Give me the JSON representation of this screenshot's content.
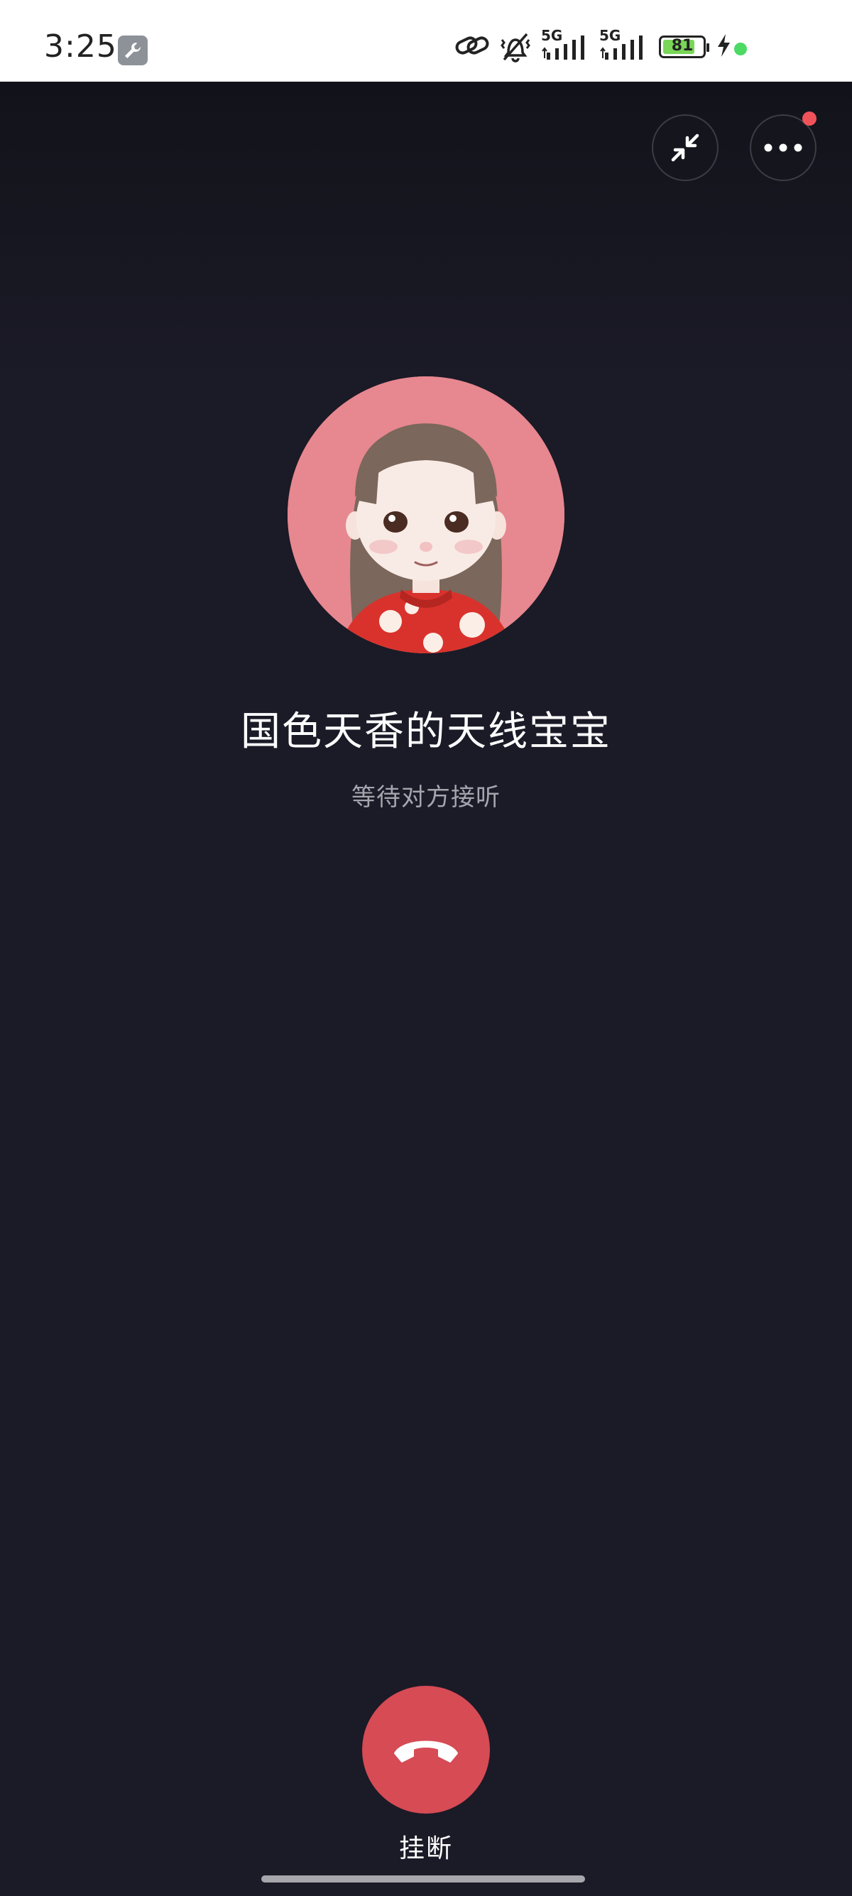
{
  "status_bar": {
    "time": "3:25",
    "network_1": "5G",
    "network_2": "5G",
    "battery_level": 81,
    "battery_label": "81",
    "charging": true
  },
  "call": {
    "contact_name": "国色天香的天线宝宝",
    "status_text": "等待对方接听",
    "hangup_label": "挂断"
  },
  "colors": {
    "background": "#1b1a27",
    "hangup": "#d64b54",
    "notification_dot": "#f0525a",
    "avatar_bg": "#e7878f"
  },
  "icons": {
    "minimize": "minimize-icon",
    "more": "more-dots-icon",
    "hangup": "phone-hangup-icon"
  }
}
